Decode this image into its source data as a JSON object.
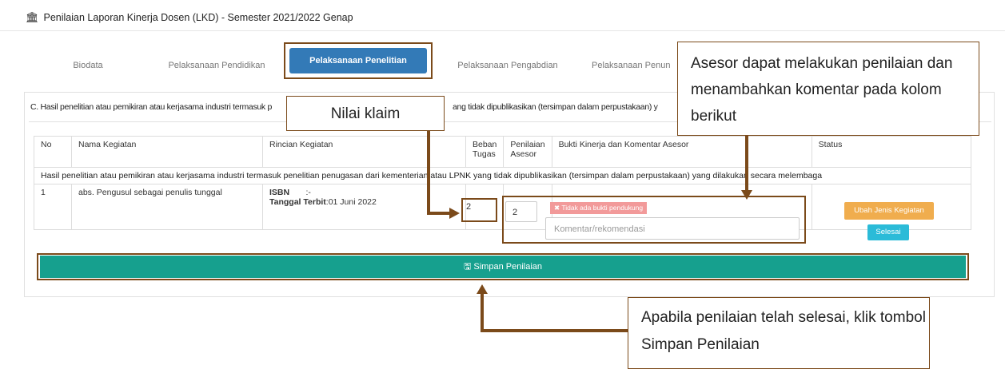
{
  "page": {
    "title": "Penilaian Laporan Kinerja Dosen (LKD) - Semester 2021/2022 Genap"
  },
  "tabs": [
    {
      "label": "Biodata"
    },
    {
      "label": "Pelaksanaan Pendidikan"
    },
    {
      "label": "Pelaksanaan Penelitian"
    },
    {
      "label": "Pelaksanaan Pengabdian"
    },
    {
      "label": "Pelaksanaan Penun"
    }
  ],
  "section": {
    "title": "C. Hasil penelitian atau pemikiran atau kerjasama industri termasuk p",
    "title_tail": "ang tidak dipublikasikan (tersimpan dalam perpustakaan) y"
  },
  "table": {
    "headers": {
      "no": "No",
      "nama": "Nama Kegiatan",
      "rincian": "Rincian Kegiatan",
      "beban": "Beban Tugas",
      "penilaian": "Penilaian Asesor",
      "bukti": "Bukti Kinerja dan Komentar Asesor",
      "status": "Status"
    },
    "group_row": "Hasil penelitian atau pemikiran atau kerjasama industri termasuk penelitian penugasan dari kementerian atau LPNK yang tidak dipublikasikan (tersimpan dalam perpustakaan) yang dilakukan secara melembaga",
    "rows": [
      {
        "no": "1",
        "nama": "abs. Pengusul sebagai penulis tunggal",
        "isbn_label": "ISBN",
        "isbn_value": ":-",
        "tanggal_label": "Tanggal Terbit",
        "tanggal_value": ":01 Juni 2022",
        "beban": "2",
        "penilaian": "2",
        "badge": "Tidak ada bukti pendukung",
        "komentar_placeholder": "Komentar/rekomendasi",
        "btn_ubah": "Ubah Jenis Kegiatan",
        "btn_selesai": "Selesai"
      }
    ]
  },
  "save_button": "Simpan Penilaian",
  "callouts": {
    "nilai": "Nilai klaim",
    "asesor": "Asesor dapat melakukan penilaian dan menambahkan komentar pada kolom berikut",
    "simpan": "Apabila penilaian telah selesai, klik tombol Simpan Penilaian"
  },
  "colors": {
    "tab_active": "#337ab7",
    "save": "#16a08e",
    "badge": "#f29a9a",
    "orange": "#f0ad4e",
    "cyan": "#2bbbd8",
    "annotation": "#7b4a1a"
  },
  "icons": [
    "institution-icon",
    "save-icon",
    "close-icon"
  ]
}
